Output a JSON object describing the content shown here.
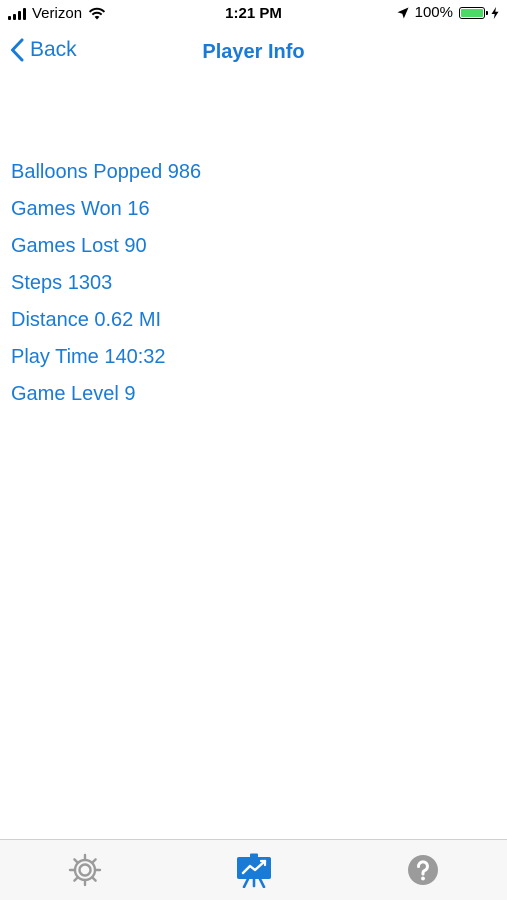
{
  "status_bar": {
    "carrier": "Verizon",
    "time": "1:21 PM",
    "battery_percent": "100%",
    "signal_bars": 4,
    "battery_level": 1.0
  },
  "nav": {
    "back_label": "Back",
    "title": "Player Info"
  },
  "stats": [
    "Balloons Popped 986",
    "Games Won 16",
    "Games Lost 90",
    "Steps 1303",
    "Distance 0.62 MI",
    "Play Time 140:32",
    "Game Level 9"
  ],
  "tab_bar": {
    "items": [
      {
        "icon": "gear-icon",
        "selected": false
      },
      {
        "icon": "presentation-chart-icon",
        "selected": true
      },
      {
        "icon": "question-icon",
        "selected": false
      }
    ]
  },
  "colors": {
    "accent": "#1a7bd6",
    "tab_inactive": "#9b9b9b",
    "battery": "#4cd964"
  }
}
